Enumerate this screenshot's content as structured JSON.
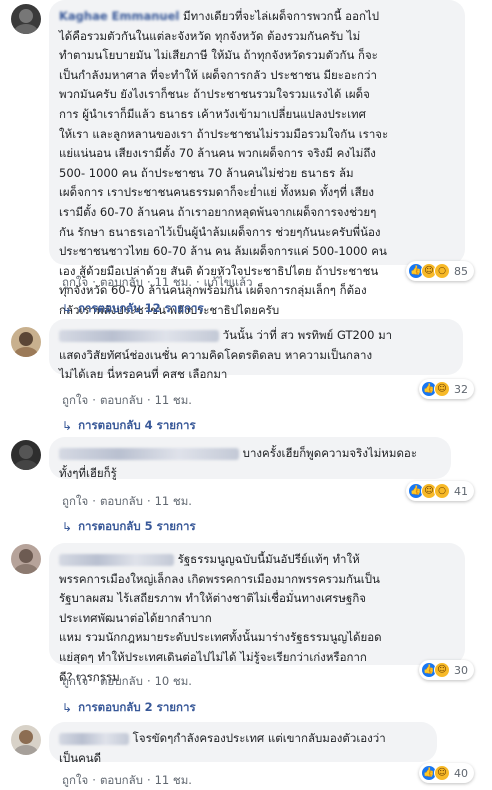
{
  "comments": [
    {
      "author": "Kaghae Emmanuel",
      "text": "มีทางเดียวที่จะไล่เผด็จการพวกนี้ ออกไป\nได้คือรวมตัวกันในแต่ละจังหวัด ทุกจังหวัด ต้องรวมกันครับ ไม่\nทำตามนโยบายมัน ไม่เสียภาษี ให้มัน ถ้าทุกจังหวัดรวมตัวกัน ก็จะ\nเป็นกำลังมหาศาล ที่จะทำให้ เผด็จการกลัว ประชาชน มียะอะกว่า\nพวกมันครับ ยังไงเราก็ชนะ ถ้าประชาชนรวมใจรวมแรงได้ เผด็จ\nการ ผู้นำเราก็มีแล้ว ธนาธร เค้าหวังเข้ามาเปลี่ยนแปลงประเทศ\nให้เรา และลูกหลานของเรา ถ้าประชาชนไม่รวมมือรวมใจกัน เราจะ\nแย่แน่นอน เสียงเรามีตั้ง 70 ล้านคน พวกเผด็จการ จริงมี คงไม่ถึง\n500- 1000 คน ถ้าประชาชน 70 ล้านคนไม่ช่วย ธนาธร ล้ม\nเผด็จการ เราประชาชนคนธรรมดาก็จะย่ำแย่ ทั้งหมด ทั้งๆที่ เสียง\nเรามีตั้ง 60-70 ล้านคน ถ้าเราอยากหลุดพ้นจากเผด็จการจงช่วยๆ\nกัน รักษา ธนาธรเอาไว้เป็นผู้นำล้มเผด็จการ ช่วยๆกันนะครับพี่น้อง\nประชาชนชาวไทย 60-70 ล้าน คน ล้มเผด็จการแค่ 500-1000 คน\nเอง สู้ด้วยมือเปล่าด้วย สันติ ด้วยหัวใจประชาธิปไตย ถ้าประชาชน\nทุกจังหวัด 60-70 ล้านคนลุกพร้อมกัน เผด็จการกลุ่มเล็กๆ ก็ต้อง\nกลัวเราพลังประชาชน พลังประชาธิปไตยครับ",
      "reaction_count": "85",
      "reactions": [
        "like",
        "haha",
        "wow"
      ],
      "actions": [
        "ถูกใจ",
        "ตอบกลับ",
        "11 ชม.",
        "แก้ไขแล้ว"
      ],
      "replies": "การตอบกลับ 12 รายการ"
    },
    {
      "author": "",
      "text": "วันนั้น ว่าที่ สว พรทิพย์ GT200 มา\nแสดงวิสัยทัศน์ช่องเนชั่น ความคิดโคตรติดลบ หาความเป็นกลาง\nไม่ได้เลย นี่หรอคนที่ คสช เลือกมา",
      "reaction_count": "32",
      "reactions": [
        "like",
        "haha"
      ],
      "actions": [
        "ถูกใจ",
        "ตอบกลับ",
        "11 ชม."
      ],
      "replies": "การตอบกลับ 4 รายการ"
    },
    {
      "author": "",
      "text": "บางครั้งเฮียก็พูดความจริงไม่หมดอะ\nทั้งๆที่เฮียก็รู้",
      "reaction_count": "41",
      "reactions": [
        "like",
        "haha",
        "wow"
      ],
      "actions": [
        "ถูกใจ",
        "ตอบกลับ",
        "11 ชม."
      ],
      "replies": "การตอบกลับ 5 รายการ"
    },
    {
      "author": "",
      "text": "รัฐธรรมนูญฉบับนี้มันอัปรีย์แท้ๆ ทำให้\nพรรคการเมืองใหญ่เล็กลง เกิดพรรคการเมืองมากพรรครวมกันเป็น\nรัฐบาลผสม ไร้เสถียรภาพ ทำให้ต่างชาติไม่เชื่อมั่นทางเศรษฐกิจ\nประเทศพัฒนาต่อได้ยากลำบาก\nแหม รวมนักกฎหมายระดับประเทศทั้งนั้นมาร่างรัฐธรรมนูญได้ยอด\nแย่สุดๆ ทำให้ประเทศเดินต่อไปไม่ได้ ไม่รู้จะเรียกว่าเก่งหรือกาก\nดี? เวรกรรม",
      "reaction_count": "30",
      "reactions": [
        "like",
        "haha"
      ],
      "actions": [
        "ถูกใจ",
        "ตอบกลับ",
        "10 ชม."
      ],
      "replies": "การตอบกลับ 2 รายการ"
    },
    {
      "author": "",
      "text": "โจรขัดๆกำลังครองประเทศ แต่เขากลับมองตัวเองว่า\nเป็นคนดี",
      "reaction_count": "40",
      "reactions": [
        "like",
        "haha"
      ],
      "actions": [
        "ถูกใจ",
        "ตอบกลับ",
        "11 ชม."
      ],
      "replies": ""
    }
  ]
}
